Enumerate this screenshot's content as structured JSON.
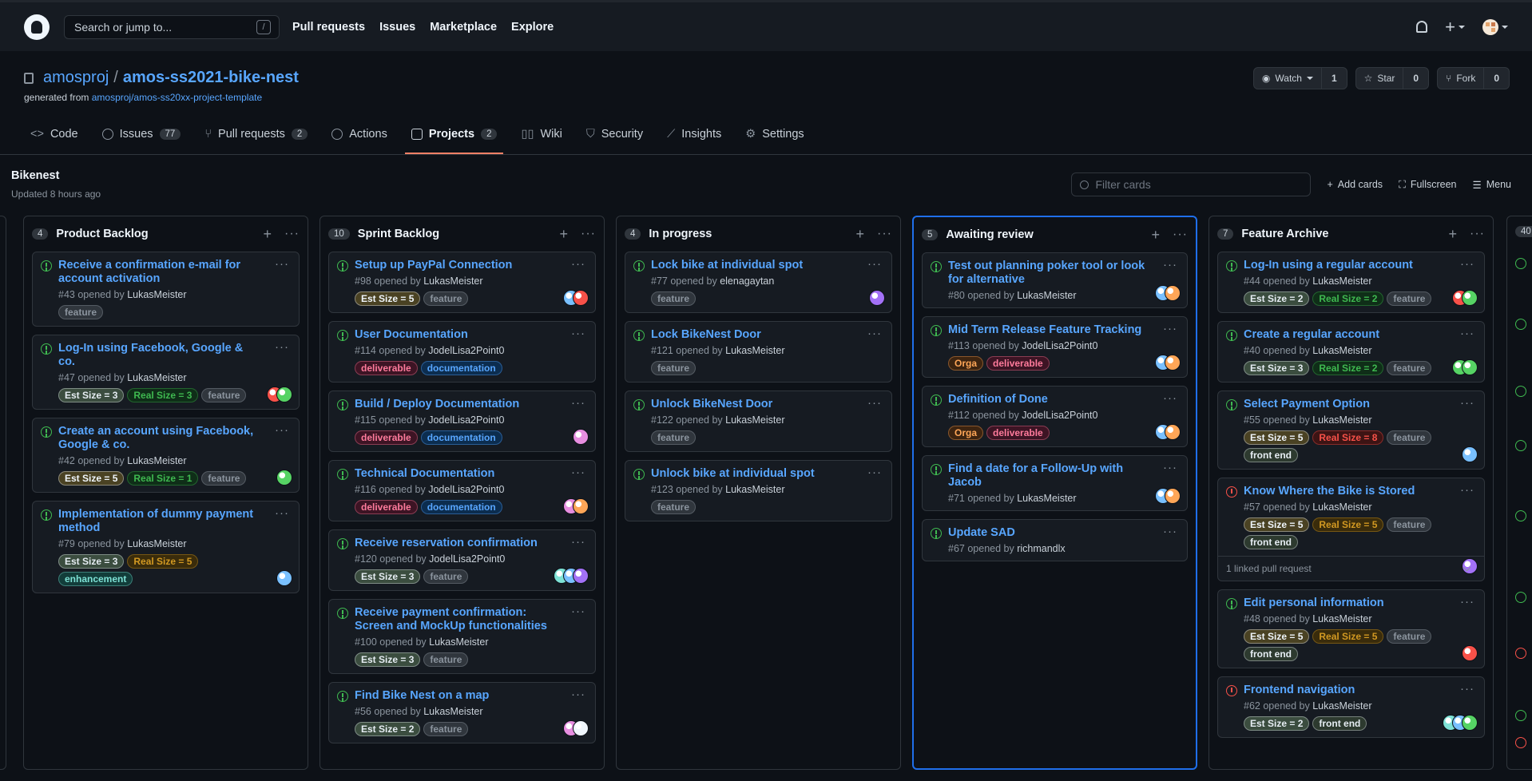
{
  "header": {
    "search_placeholder": "Search or jump to...",
    "search_key": "/",
    "nav": [
      "Pull requests",
      "Issues",
      "Marketplace",
      "Explore"
    ]
  },
  "repo": {
    "owner": "amosproj",
    "separator": "/",
    "name": "amos-ss2021-bike-nest",
    "generated_prefix": "generated from",
    "template_link": "amosproj/amos-ss20xx-project-template",
    "watch": {
      "label": "Watch",
      "count": "1"
    },
    "star": {
      "label": "Star",
      "count": "0"
    },
    "fork": {
      "label": "Fork",
      "count": "0"
    }
  },
  "tabs": [
    {
      "label": "Code",
      "count": ""
    },
    {
      "label": "Issues",
      "count": "77"
    },
    {
      "label": "Pull requests",
      "count": "2"
    },
    {
      "label": "Actions",
      "count": ""
    },
    {
      "label": "Projects",
      "count": "2"
    },
    {
      "label": "Wiki",
      "count": ""
    },
    {
      "label": "Security",
      "count": ""
    },
    {
      "label": "Insights",
      "count": ""
    },
    {
      "label": "Settings",
      "count": ""
    }
  ],
  "project": {
    "name": "Bikenest",
    "updated": "Updated 8 hours ago",
    "filter_placeholder": "Filter cards",
    "add_cards": "Add cards",
    "fullscreen": "Fullscreen",
    "menu": "Menu"
  },
  "next_col_count": "40",
  "colors": {
    "accent": "#58a6ff",
    "open": "#3fb950",
    "closed": "#f85149",
    "active_tab": "#f78166",
    "highlight_border": "#1f6feb"
  },
  "columns": [
    {
      "count": "4",
      "name": "Product Backlog",
      "cards": [
        {
          "title": "Receive a confirmation e-mail for account activation",
          "num": "#43",
          "by": "LukasMeister",
          "labels": [
            {
              "text": "feature",
              "c": "#8b949e",
              "bg": "#30363d"
            }
          ],
          "avatars": []
        },
        {
          "title": "Log-In using Facebook, Google & co.",
          "num": "#47",
          "by": "LukasMeister",
          "labels": [
            {
              "text": "Est Size = 3",
              "c": "#e6edf3",
              "bg": "#3b4d3f"
            },
            {
              "text": "Real Size = 3",
              "c": "#3fb950",
              "bg": "#0f2e18"
            },
            {
              "text": "feature",
              "c": "#8b949e",
              "bg": "#30363d"
            }
          ],
          "avatars": [
            "#f85149",
            "#56d364"
          ]
        },
        {
          "title": "Create an account using Facebook, Google & co.",
          "num": "#42",
          "by": "LukasMeister",
          "labels": [
            {
              "text": "Est Size = 5",
              "c": "#f0f6fc",
              "bg": "#4a4223"
            },
            {
              "text": "Real Size = 1",
              "c": "#3fb950",
              "bg": "#0f2e18"
            },
            {
              "text": "feature",
              "c": "#8b949e",
              "bg": "#30363d"
            }
          ],
          "avatars": [
            "#56d364"
          ]
        },
        {
          "title": "Implementation of dummy payment method",
          "num": "#79",
          "by": "LukasMeister",
          "labels": [
            {
              "text": "Est Size = 3",
              "c": "#e6edf3",
              "bg": "#3b4d3f"
            },
            {
              "text": "Real Size = 5",
              "c": "#d29922",
              "bg": "#3a2c0b"
            },
            {
              "text": "enhancement",
              "c": "#7ee2d6",
              "bg": "#123d3a"
            }
          ],
          "avatars": [
            "#79c0ff"
          ]
        }
      ]
    },
    {
      "count": "10",
      "name": "Sprint Backlog",
      "cards": [
        {
          "title": "Setup up PayPal Connection",
          "num": "#98",
          "by": "LukasMeister",
          "labels": [
            {
              "text": "Est Size = 5",
              "c": "#f0f6fc",
              "bg": "#4a4223"
            },
            {
              "text": "feature",
              "c": "#8b949e",
              "bg": "#30363d"
            }
          ],
          "avatars": [
            "#79c0ff",
            "#f85149"
          ]
        },
        {
          "title": "User Documentation",
          "num": "#114",
          "by": "JodelLisa2Point0",
          "labels": [
            {
              "text": "deliverable",
              "c": "#ff7b9c",
              "bg": "#3d1424"
            },
            {
              "text": "documentation",
              "c": "#58a6ff",
              "bg": "#0c2d4f"
            }
          ],
          "avatars": []
        },
        {
          "title": "Build / Deploy Documentation",
          "num": "#115",
          "by": "JodelLisa2Point0",
          "labels": [
            {
              "text": "deliverable",
              "c": "#ff7b9c",
              "bg": "#3d1424"
            },
            {
              "text": "documentation",
              "c": "#58a6ff",
              "bg": "#0c2d4f"
            }
          ],
          "avatars": [
            "#e78ee0"
          ]
        },
        {
          "title": "Technical Documentation",
          "num": "#116",
          "by": "JodelLisa2Point0",
          "labels": [
            {
              "text": "deliverable",
              "c": "#ff7b9c",
              "bg": "#3d1424"
            },
            {
              "text": "documentation",
              "c": "#58a6ff",
              "bg": "#0c2d4f"
            }
          ],
          "avatars": [
            "#e78ee0",
            "#ffa657"
          ]
        },
        {
          "title": "Receive reservation confirmation",
          "num": "#120",
          "by": "JodelLisa2Point0",
          "labels": [
            {
              "text": "Est Size = 3",
              "c": "#e6edf3",
              "bg": "#3b4d3f"
            },
            {
              "text": "feature",
              "c": "#8b949e",
              "bg": "#30363d"
            }
          ],
          "avatars": [
            "#7ee2d6",
            "#79c0ff",
            "#a371f7"
          ]
        },
        {
          "title": "Receive payment confirmation: Screen and MockUp functionalities",
          "num": "#100",
          "by": "LukasMeister",
          "labels": [
            {
              "text": "Est Size = 3",
              "c": "#e6edf3",
              "bg": "#3b4d3f"
            },
            {
              "text": "feature",
              "c": "#8b949e",
              "bg": "#30363d"
            }
          ],
          "avatars": []
        },
        {
          "title": "Find Bike Nest on a map",
          "num": "#56",
          "by": "LukasMeister",
          "labels": [
            {
              "text": "Est Size = 2",
              "c": "#e6edf3",
              "bg": "#3b4d3f"
            },
            {
              "text": "feature",
              "c": "#8b949e",
              "bg": "#30363d"
            }
          ],
          "avatars": [
            "#e78ee0",
            "#f0f6fc"
          ]
        }
      ]
    },
    {
      "count": "4",
      "name": "In progress",
      "cards": [
        {
          "title": "Lock bike at individual spot",
          "num": "#77",
          "by": "elenagaytan",
          "labels": [
            {
              "text": "feature",
              "c": "#8b949e",
              "bg": "#30363d"
            }
          ],
          "avatars": [
            "#a371f7"
          ]
        },
        {
          "title": "Lock BikeNest Door",
          "num": "#121",
          "by": "LukasMeister",
          "labels": [
            {
              "text": "feature",
              "c": "#8b949e",
              "bg": "#30363d"
            }
          ],
          "avatars": []
        },
        {
          "title": "Unlock BikeNest Door",
          "num": "#122",
          "by": "LukasMeister",
          "labels": [
            {
              "text": "feature",
              "c": "#8b949e",
              "bg": "#30363d"
            }
          ],
          "avatars": []
        },
        {
          "title": "Unlock bike at individual spot",
          "num": "#123",
          "by": "LukasMeister",
          "labels": [
            {
              "text": "feature",
              "c": "#8b949e",
              "bg": "#30363d"
            }
          ],
          "avatars": []
        }
      ]
    },
    {
      "count": "5",
      "name": "Awaiting review",
      "cards": [
        {
          "title": "Test out planning poker tool or look for alternative",
          "num": "#80",
          "by": "LukasMeister",
          "labels": [],
          "avatars": [
            "#79c0ff",
            "#ffa657"
          ]
        },
        {
          "title": "Mid Term Release Feature Tracking",
          "num": "#113",
          "by": "JodelLisa2Point0",
          "labels": [
            {
              "text": "Orga",
              "c": "#ffa657",
              "bg": "#3d2410"
            },
            {
              "text": "deliverable",
              "c": "#ff7b9c",
              "bg": "#3d1424"
            }
          ],
          "avatars": [
            "#79c0ff",
            "#ffa657"
          ]
        },
        {
          "title": "Definition of Done",
          "num": "#112",
          "by": "JodelLisa2Point0",
          "labels": [
            {
              "text": "Orga",
              "c": "#ffa657",
              "bg": "#3d2410"
            },
            {
              "text": "deliverable",
              "c": "#ff7b9c",
              "bg": "#3d1424"
            }
          ],
          "avatars": [
            "#79c0ff",
            "#ffa657"
          ]
        },
        {
          "title": "Find a date for a Follow-Up with Jacob",
          "num": "#71",
          "by": "LukasMeister",
          "labels": [],
          "avatars": [
            "#79c0ff",
            "#ffa657"
          ]
        },
        {
          "title": "Update SAD",
          "num": "#67",
          "by": "richmandlx",
          "labels": [],
          "avatars": []
        }
      ]
    },
    {
      "count": "7",
      "name": "Feature Archive",
      "cards": [
        {
          "title": "Log-In using a regular account",
          "num": "#44",
          "by": "LukasMeister",
          "labels": [
            {
              "text": "Est Size = 2",
              "c": "#e6edf3",
              "bg": "#3b4d3f"
            },
            {
              "text": "Real Size = 2",
              "c": "#3fb950",
              "bg": "#0f2e18"
            },
            {
              "text": "feature",
              "c": "#8b949e",
              "bg": "#30363d"
            }
          ],
          "avatars": [
            "#f85149",
            "#56d364"
          ]
        },
        {
          "title": "Create a regular account",
          "num": "#40",
          "by": "LukasMeister",
          "labels": [
            {
              "text": "Est Size = 3",
              "c": "#e6edf3",
              "bg": "#3b4d3f"
            },
            {
              "text": "Real Size = 2",
              "c": "#3fb950",
              "bg": "#0f2e18"
            },
            {
              "text": "feature",
              "c": "#8b949e",
              "bg": "#30363d"
            }
          ],
          "avatars": [
            "#56d364",
            "#56d364"
          ]
        },
        {
          "title": "Select Payment Option",
          "num": "#55",
          "by": "LukasMeister",
          "labels": [
            {
              "text": "Est Size = 5",
              "c": "#f0f6fc",
              "bg": "#4a4223"
            },
            {
              "text": "Real Size = 8",
              "c": "#f85149",
              "bg": "#3d1414"
            },
            {
              "text": "feature",
              "c": "#8b949e",
              "bg": "#30363d"
            },
            {
              "text": "front end",
              "c": "#e6edf3",
              "bg": "#2d3a2f"
            }
          ],
          "avatars": [
            "#79c0ff"
          ]
        },
        {
          "title": "Know Where the Bike is Stored",
          "num": "#57",
          "by": "LukasMeister",
          "closed": true,
          "labels": [
            {
              "text": "Est Size = 5",
              "c": "#f0f6fc",
              "bg": "#4a4223"
            },
            {
              "text": "Real Size = 5",
              "c": "#d29922",
              "bg": "#3a2c0b"
            },
            {
              "text": "feature",
              "c": "#8b949e",
              "bg": "#30363d"
            },
            {
              "text": "front end",
              "c": "#e6edf3",
              "bg": "#2d3a2f"
            }
          ],
          "avatars": [
            "#a371f7"
          ],
          "linked": "1 linked pull request"
        },
        {
          "title": "Edit personal information",
          "num": "#48",
          "by": "LukasMeister",
          "labels": [
            {
              "text": "Est Size = 5",
              "c": "#f0f6fc",
              "bg": "#4a4223"
            },
            {
              "text": "Real Size = 5",
              "c": "#d29922",
              "bg": "#3a2c0b"
            },
            {
              "text": "feature",
              "c": "#8b949e",
              "bg": "#30363d"
            },
            {
              "text": "front end",
              "c": "#e6edf3",
              "bg": "#2d3a2f"
            }
          ],
          "avatars": [
            "#f85149"
          ]
        },
        {
          "title": "Frontend navigation",
          "num": "#62",
          "by": "LukasMeister",
          "closed": true,
          "labels": [
            {
              "text": "Est Size = 2",
              "c": "#e6edf3",
              "bg": "#3b4d3f"
            },
            {
              "text": "front end",
              "c": "#e6edf3",
              "bg": "#2d3a2f"
            }
          ],
          "avatars": [
            "#7ee2d6",
            "#79c0ff",
            "#56d364"
          ]
        }
      ]
    }
  ]
}
